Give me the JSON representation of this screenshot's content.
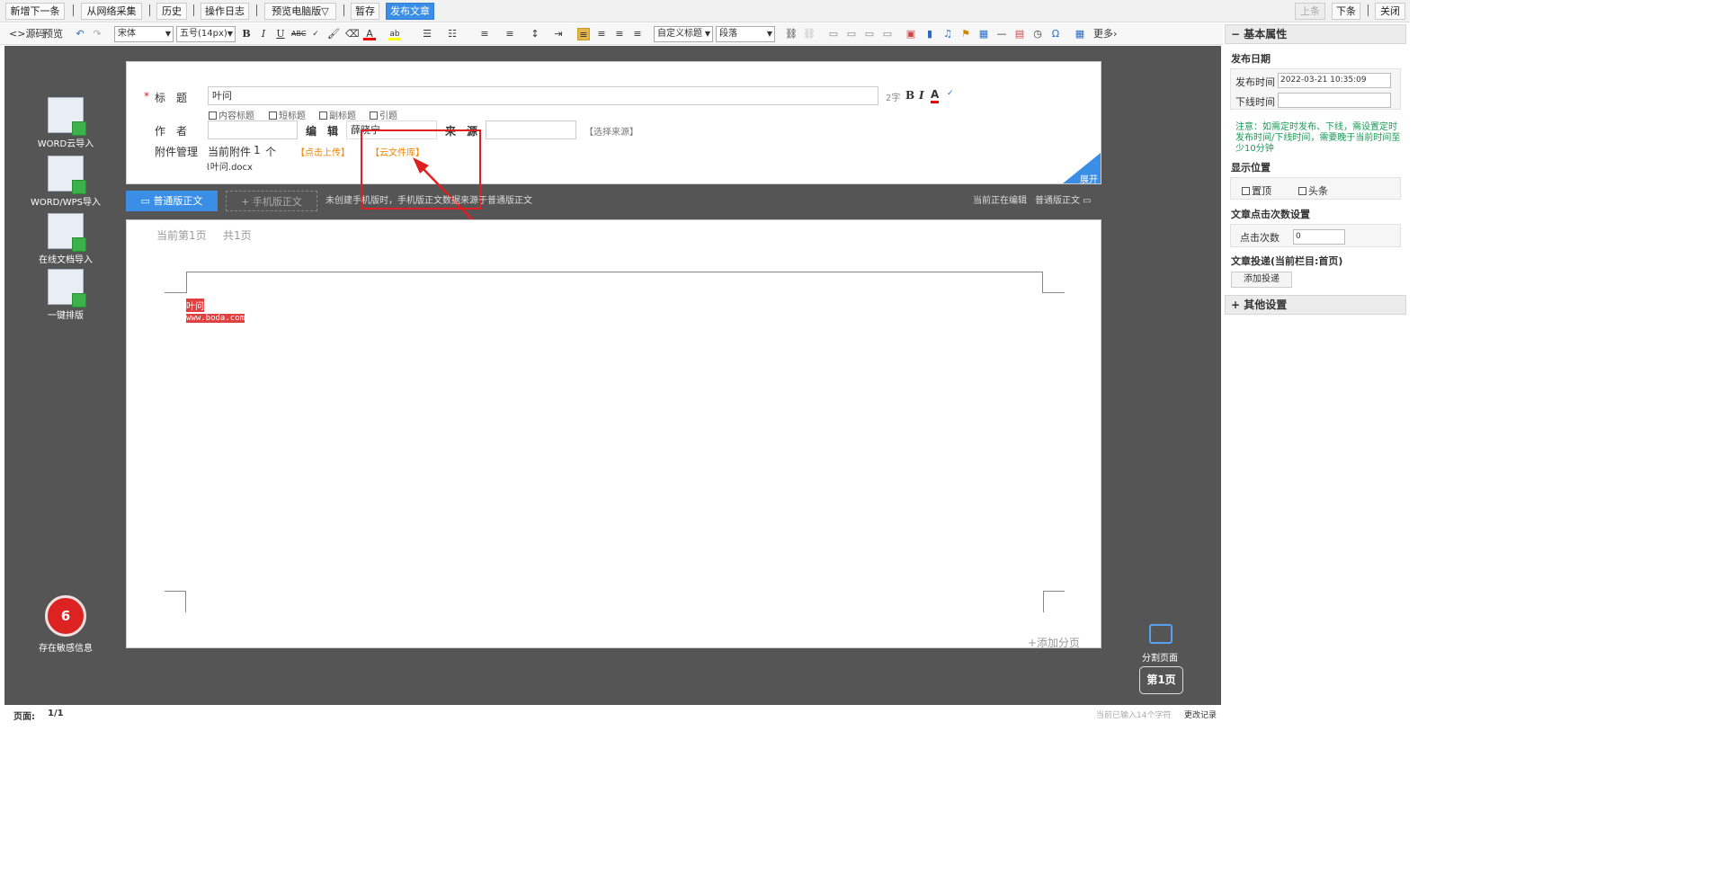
{
  "topbar": {
    "new_next": "新增下一条",
    "web_collect": "从网络采集",
    "history": "历史",
    "op_log": "操作日志",
    "preview": "预览电脑版▽",
    "draft": "暂存",
    "publish": "发布文章",
    "prev": "上条",
    "next": "下条",
    "close": "关闭"
  },
  "toolbar": {
    "source": "源码",
    "preview": "预览",
    "font": "宋体",
    "size": "五号(14px)",
    "custom_heading": "自定义标题",
    "paragraph": "段落",
    "more": "更多"
  },
  "left_tools": [
    {
      "label": "WORD云导入",
      "icon": "word-cloud-import-icon"
    },
    {
      "label": "WORD/WPS导入",
      "icon": "word-wps-import-icon"
    },
    {
      "label": "在线文档导入",
      "icon": "online-doc-import-icon"
    },
    {
      "label": "一键排版",
      "icon": "one-click-layout-icon"
    }
  ],
  "sensitive": {
    "count": "6",
    "label": "存在敏感信息"
  },
  "form": {
    "required_mark": "*",
    "title_label": "标　题",
    "title_value": "叶问",
    "char_count": "2字",
    "opts": [
      "内容标题",
      "短标题",
      "副标题",
      "引题"
    ],
    "author_label": "作　者",
    "author_value": "",
    "editor_label": "编　辑",
    "editor_value": "薛晓宁",
    "source_label": "来　源",
    "source_value": "",
    "select_source": "【选择来源】",
    "attach_label": "附件管理",
    "attach_current": "当前附件",
    "attach_count": "1",
    "attach_unit": "个",
    "upload": "【点击上传】",
    "cloud_lib": "【云文件库】",
    "attach_file": "叶问.docx",
    "expand": "展开"
  },
  "tabs": {
    "pc": "普通版正文",
    "mobile": "+ 手机版正文",
    "note": "未创建手机版时，手机版正文数据来源于普通版正文",
    "editing": "当前正在编辑",
    "editing_mode": "普通版正文"
  },
  "editor": {
    "page_current": "当前第1页",
    "page_total": "共1页",
    "line1": "叶问",
    "line2": "www.boda.com",
    "add_page": "+添加分页"
  },
  "right_bottom": {
    "split": "分割页面",
    "page": "第1页"
  },
  "right_panel": {
    "basic_title": "基本属性",
    "publish_date": "发布日期",
    "publish_time_label": "发布时间",
    "publish_time_value": "2022-03-21 10:35:09",
    "offline_label": "下线时间",
    "offline_value": "",
    "note": "注意：如需定时发布、下线，需设置定时发布时间/下线时间，需要晚于当前时间至少10分钟",
    "display_pos": "显示位置",
    "top": "置顶",
    "headline": "头条",
    "clicks_title": "文章点击次数设置",
    "clicks_label": "点击次数",
    "clicks_value": "0",
    "deliver_title": "文章投递(当前栏目:首页)",
    "add_deliver": "添加投递",
    "other_title": "其他设置"
  },
  "status": {
    "page_label": "页面:",
    "page_value": "1/1",
    "typed": "当前已输入14个字符",
    "change_log": "更改记录"
  }
}
